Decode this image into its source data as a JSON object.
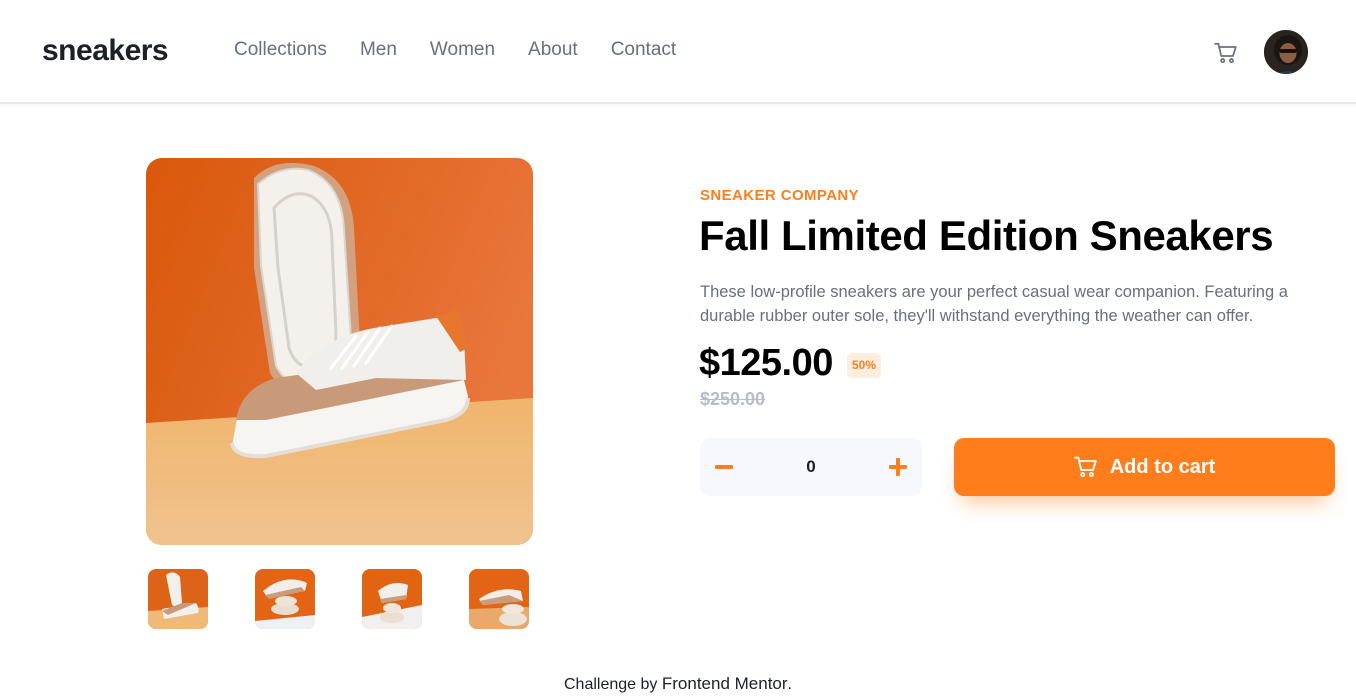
{
  "header": {
    "logo": "sneakers",
    "nav": [
      "Collections",
      "Men",
      "Women",
      "About",
      "Contact"
    ]
  },
  "product": {
    "company": "SNEAKER COMPANY",
    "title": "Fall Limited Edition Sneakers",
    "description": "These low-profile sneakers are your perfect casual wear companion. Featuring a durable rubber outer sole, they'll withstand everything the weather can offer.",
    "price": "$125.00",
    "discount": "50%",
    "original_price": "$250.00",
    "quantity": "0",
    "add_to_cart_label": "Add to cart"
  },
  "footer": {
    "prefix": "Challenge by",
    "link": "Frontend Mentor",
    "suffix": "."
  },
  "colors": {
    "accent": "#ff7e1b",
    "accent_pale": "#ffede0",
    "text_dark": "#1d2026",
    "text_gray": "#68707d",
    "text_light": "#b6bcc8",
    "qty_bg": "#f6f8fd"
  },
  "icons": {
    "cart": "cart-icon",
    "minus": "minus-icon",
    "plus": "plus-icon"
  }
}
